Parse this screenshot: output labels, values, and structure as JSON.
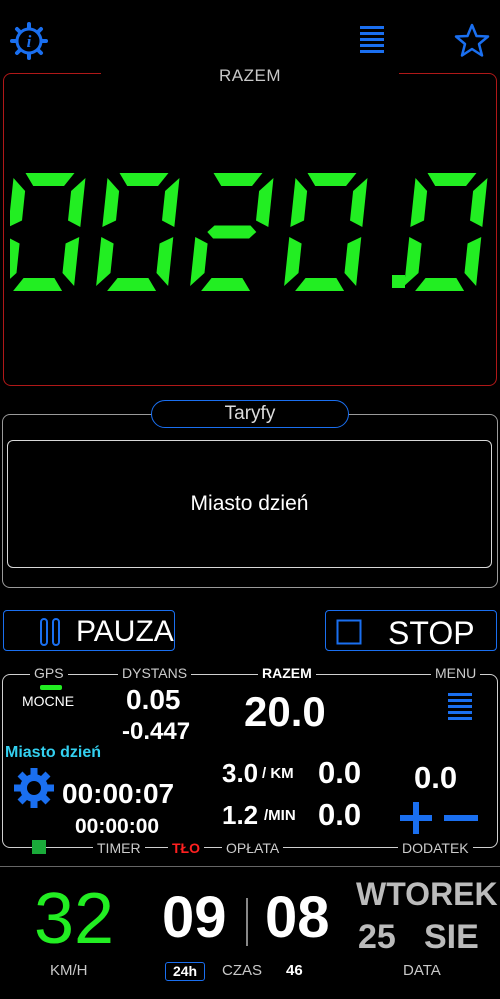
{
  "total": {
    "label": "RAZEM",
    "value": "0020.0"
  },
  "tariffs": {
    "header": "Taryfy",
    "selected": "Miasto dzień"
  },
  "controls": {
    "pause_label": "PAUZA",
    "stop_label": "STOP"
  },
  "stats": {
    "gps_label": "GPS",
    "gps_strength": "MOCNE",
    "distance_label": "DYSTANS",
    "distance_value": "0.05",
    "distance_delta": "-0.447",
    "total_label": "RAZEM",
    "total_value": "20.0",
    "menu_label": "MENU",
    "tariff_name": "Miasto dzień",
    "timer_value": "00:00:07",
    "timer_sub": "00:00:00",
    "rate_km": "3.0",
    "rate_km_unit": "/ KM",
    "rate_km_amount": "0.0",
    "rate_min": "1.2",
    "rate_min_unit": "/MIN",
    "rate_min_amount": "0.0",
    "extra_value": "0.0",
    "timer_label": "TIMER",
    "bg_label": "TŁO",
    "fee_label": "OPŁATA",
    "extra_label": "DODATEK"
  },
  "bottom": {
    "speed_value": "32",
    "speed_unit": "KM/H",
    "hour": "09",
    "minute": "08",
    "format_badge": "24h",
    "time_label": "CZAS",
    "seconds": "46",
    "weekday": "WTOREK",
    "day": "25",
    "month": "SIE",
    "date_label": "DATA"
  },
  "colors": {
    "accent": "#1a6ff0",
    "digits": "#22ee22",
    "total_frame": "#b01818"
  }
}
